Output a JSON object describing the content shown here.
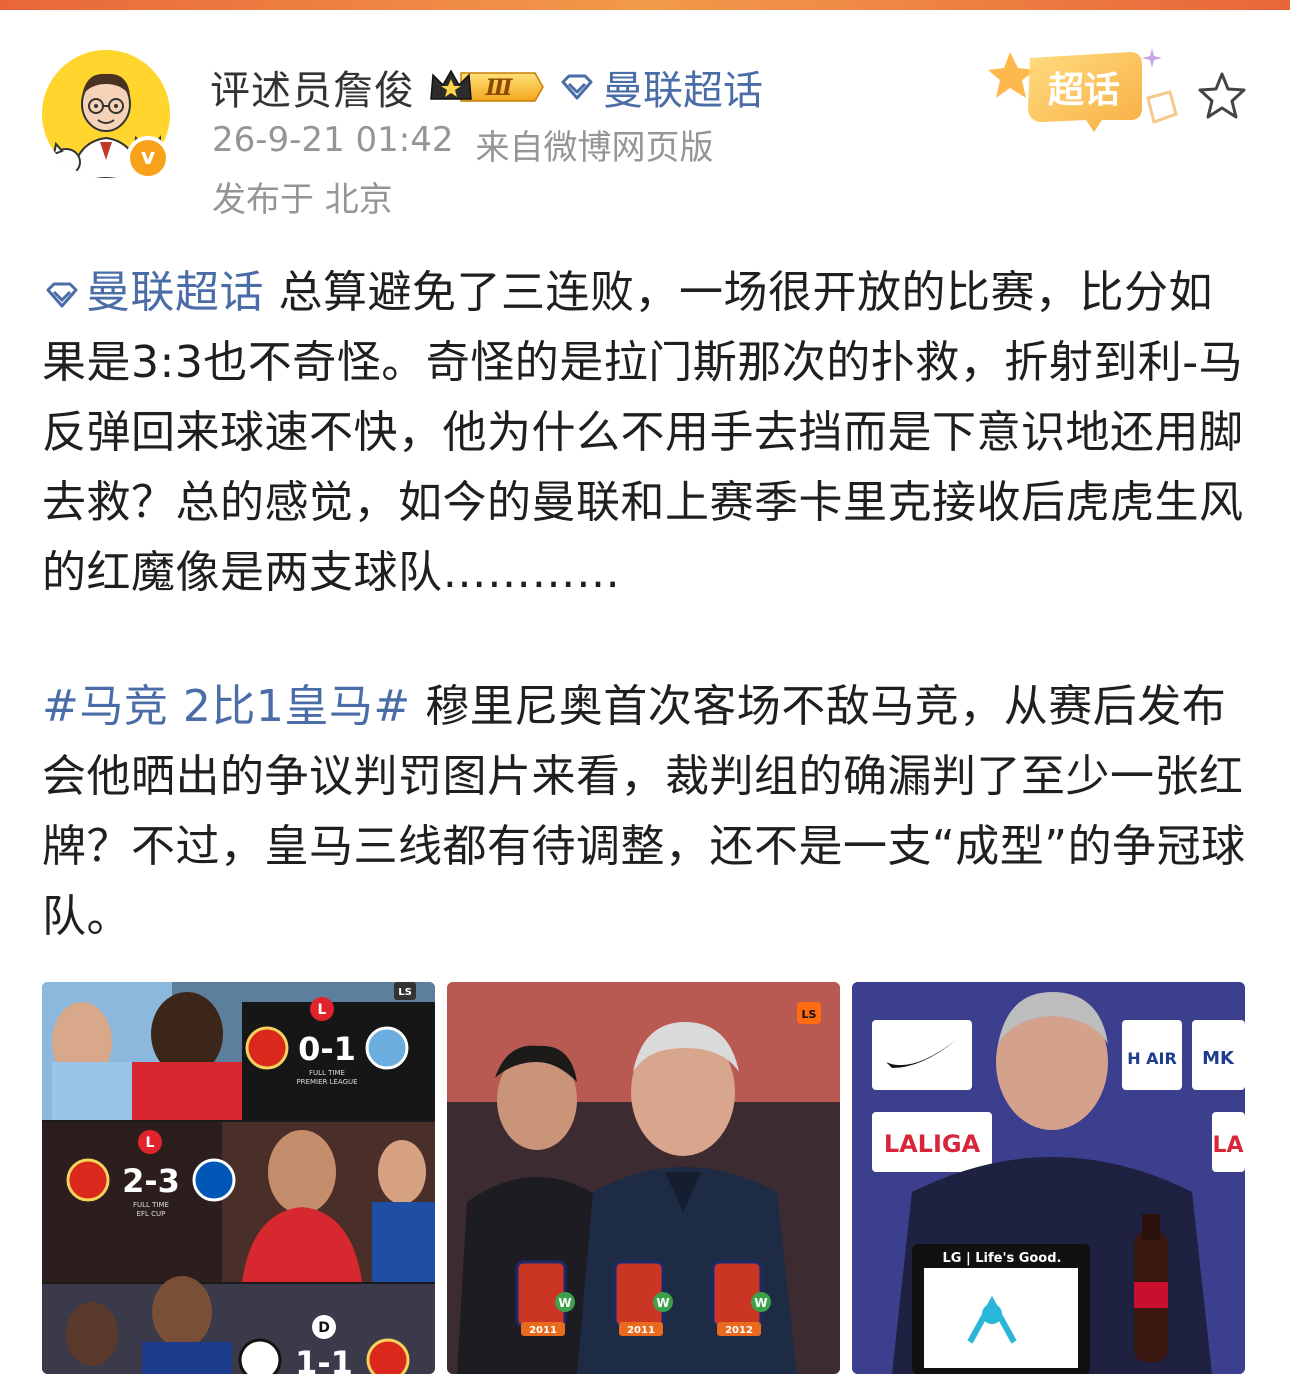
{
  "post": {
    "author": "评述员詹俊",
    "rank_badge": "Ⅲ",
    "topic": "曼联超话",
    "timestamp": "26-9-21 01:42",
    "source": "来自微博网页版",
    "location": "发布于 北京",
    "super_topic_badge": "超话",
    "paragraph1": {
      "topic_link": "曼联超话",
      "text": " 总算避免了三连败，一场很开放的比赛，比分如果是3:3也不奇怪。奇怪的是拉门斯那次的扑救，折射到利-马反弹回来球速不快，他为什么不用手去挡而是下意识地还用脚去救？总的感觉，如今的曼联和上赛季卡里克接收后虎虎生风的红魔像是两支球队…………"
    },
    "paragraph2": {
      "hashtag": "#马竞 2比1皇马#",
      "text": " 穆里尼奥首次客场不敌马竞，从赛后发布会他晒出的争议判罚图片来看，裁判组的确漏判了至少一张红牌？不过，皇马三线都有待调整，还不是一支“成型”的争冠球队。"
    }
  },
  "images": {
    "photo1": {
      "logo": "LS",
      "match1": {
        "badge": "L",
        "score": "0-1",
        "note1": "FULL TIME",
        "note2": "PREMIER LEAGUE"
      },
      "match2": {
        "badge": "L",
        "score": "2-3",
        "note1": "FULL TIME",
        "note2": "EFL CUP"
      },
      "match3": {
        "badge": "D",
        "score": "1-1"
      }
    },
    "photo2": {
      "logo": "LS",
      "years": [
        "2011",
        "2011",
        "2012"
      ],
      "result_badge": "W"
    },
    "photo3": {
      "board1": "LALIGA",
      "board2": "LA",
      "board3": "H AIR",
      "board4": "MK",
      "lectern": "LG | Life's Good."
    }
  },
  "colors": {
    "link": "#4a6da8",
    "meta": "#959595",
    "accent_orange": "#f7a21a"
  }
}
